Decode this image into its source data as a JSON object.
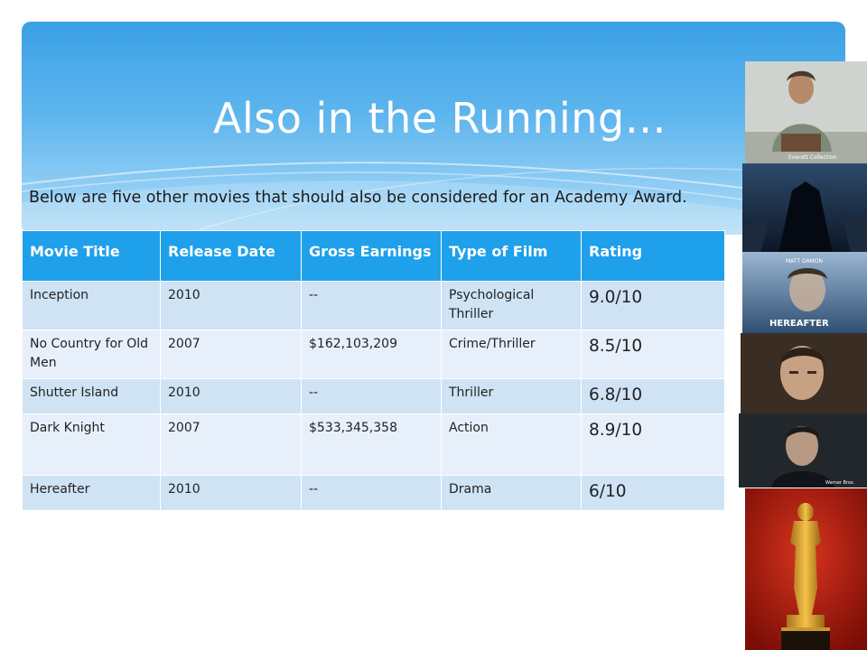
{
  "slide": {
    "title": "Also in the Running…",
    "subtitle": "Below are five other movies that should also be considered for an Academy Award."
  },
  "table": {
    "headers": [
      "Movie Title",
      "Release Date",
      "Gross Earnings",
      "Type of Film",
      "Rating"
    ],
    "rows": [
      [
        "Inception",
        "2010",
        "--",
        "Psychological Thriller",
        "9.0/10"
      ],
      [
        "No Country for Old Men",
        "2007",
        "$162,103,209",
        "Crime/Thriller",
        "8.5/10"
      ],
      [
        "Shutter Island",
        "2010",
        "--",
        "Thriller",
        "6.8/10"
      ],
      [
        "Dark Knight",
        "2007",
        "$533,345,358",
        "Action",
        "8.9/10"
      ],
      [
        "Hereafter",
        "2010",
        "--",
        "Drama",
        "6/10"
      ]
    ]
  },
  "images": {
    "poster1_caption": "Everett Collection",
    "poster3_actor": "MATT DAMON",
    "poster3_title": "HEREAFTER",
    "poster5_caption": "Warner Bros."
  },
  "colors": {
    "banner": "#3aa0e6",
    "header_row": "#1fa0ea",
    "row_odd": "#cfe3f5",
    "row_even": "#e7f0fa"
  }
}
